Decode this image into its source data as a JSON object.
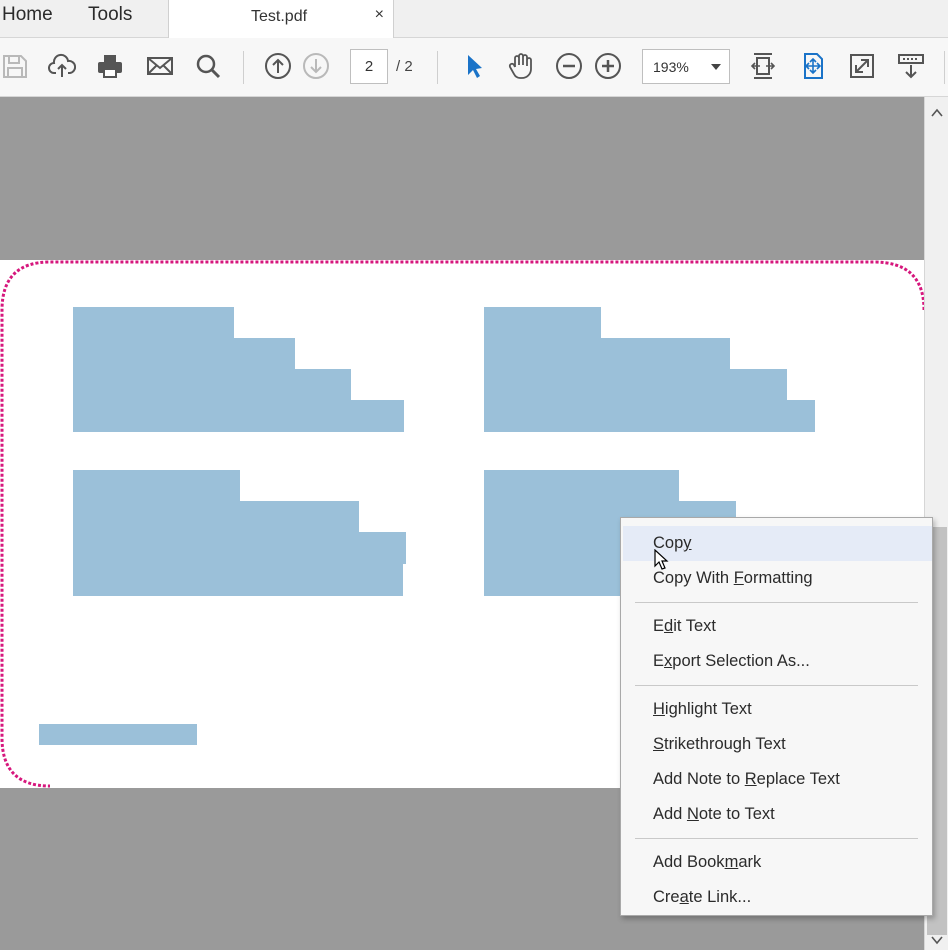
{
  "tabs": {
    "home": "Home",
    "tools": "Tools",
    "document": "Test.pdf",
    "close": "×"
  },
  "toolbar": {
    "icons": [
      "save-icon",
      "upload-cloud-icon",
      "print-icon",
      "email-icon",
      "search-icon",
      "page-up-icon",
      "page-down-icon",
      "select-pointer-icon",
      "hand-icon",
      "zoom-out-icon",
      "zoom-in-icon",
      "fit-width-icon",
      "fit-page-icon",
      "full-screen-icon",
      "read-mode-icon"
    ],
    "page_current": "2",
    "page_total": "/ 2",
    "zoom": "193%"
  },
  "colors": {
    "accent": "#1a73c8",
    "selection": "#9bc0d9",
    "page_border": "#d6177d",
    "menu_hover": "#e5ebf7"
  },
  "context_menu": {
    "items": [
      {
        "label": "Copy",
        "mnemonic": "y"
      },
      {
        "label": "Copy With Formatting",
        "mnemonic": "F"
      },
      {
        "label": "Edit Text",
        "mnemonic": "d"
      },
      {
        "label": "Export Selection As...",
        "mnemonic": "x"
      },
      {
        "label": "Highlight Text",
        "mnemonic": "H"
      },
      {
        "label": "Strikethrough Text",
        "mnemonic": "S"
      },
      {
        "label": "Add Note to Replace Text",
        "mnemonic": "R"
      },
      {
        "label": "Add Note to Text",
        "mnemonic": "N"
      },
      {
        "label": "Add Bookmark",
        "mnemonic": "m"
      },
      {
        "label": "Create Link...",
        "mnemonic": "a"
      }
    ]
  }
}
